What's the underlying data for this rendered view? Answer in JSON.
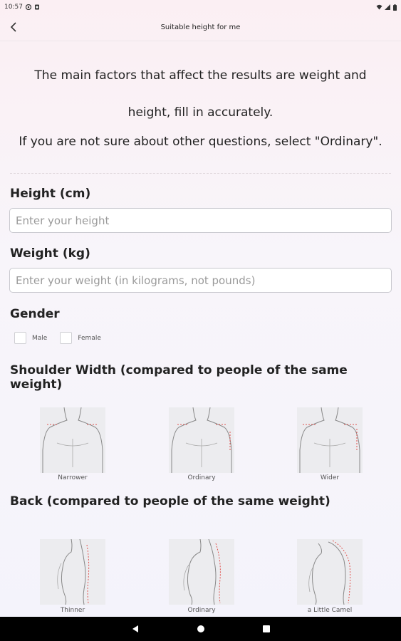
{
  "status": {
    "time": "10:57",
    "left_icons": [
      "sync-icon",
      "sim-icon"
    ],
    "right_icons": [
      "wifi-icon",
      "signal-icon",
      "battery-icon"
    ]
  },
  "app_bar": {
    "title": "Suitable height for me",
    "back_icon": "chevron-left-icon"
  },
  "intro": {
    "line1": "The main factors that affect the results are weight and",
    "line2": "height, fill in accurately.",
    "line3": "If you are not sure about other questions, select \"Ordinary\"."
  },
  "height": {
    "label": "Height (cm)",
    "placeholder": "Enter your height",
    "value": ""
  },
  "weight": {
    "label": "Weight (kg)",
    "placeholder": "Enter your weight (in kilograms, not pounds)",
    "value": ""
  },
  "gender": {
    "label": "Gender",
    "options": [
      {
        "label": "Male",
        "checked": false
      },
      {
        "label": "Female",
        "checked": false
      }
    ]
  },
  "shoulder": {
    "label": "Shoulder Width (compared to people of the same weight)",
    "options": [
      "Narrower",
      "Ordinary",
      "Wider"
    ]
  },
  "back": {
    "label": "Back (compared to people of the same weight)",
    "options": [
      "Thinner",
      "Ordinary",
      "a Little Camel"
    ]
  },
  "colors": {
    "accent_dashes": "#e0524e",
    "figure_bg": "#ececef",
    "nav_bar": "#000000"
  }
}
